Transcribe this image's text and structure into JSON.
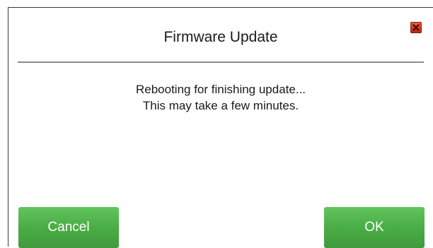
{
  "dialog": {
    "title": "Firmware Update",
    "close_icon": "close-icon",
    "message_line1": "Rebooting for finishing update...",
    "message_line2": "This may take a few minutes.",
    "cancel_label": "Cancel",
    "ok_label": "OK"
  },
  "colors": {
    "button_green": "#4caf47",
    "close_red": "#d9341c",
    "divider": "#8c8c8c"
  }
}
